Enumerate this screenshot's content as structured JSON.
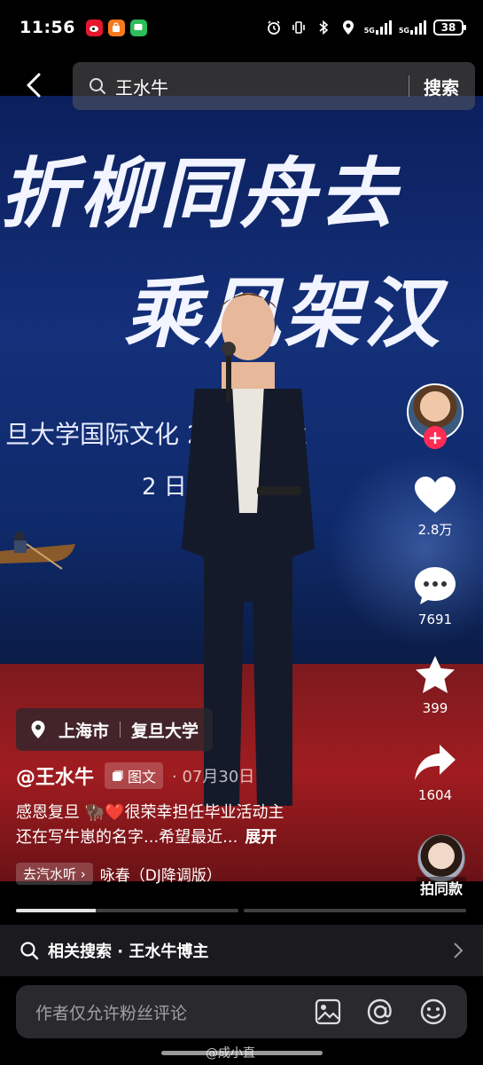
{
  "status_bar": {
    "time": "11:56",
    "network_1": "5G",
    "network_2": "5G",
    "battery": "38"
  },
  "search": {
    "query": "王水牛",
    "button_label": "搜索"
  },
  "video": {
    "banner_line1": "折柳同舟去",
    "banner_line2": "乘风架汉",
    "banner_line3": "旦大学国际文化   2026届   业",
    "banner_line4": "2         日"
  },
  "actions": {
    "likes": "2.8万",
    "comments": "7691",
    "favorites": "399",
    "shares": "1604"
  },
  "location": {
    "city": "上海市",
    "place": "复旦大学"
  },
  "post": {
    "author": "@王水牛",
    "type_tag": "图文",
    "date": "· 07月30日",
    "caption_line1": "感恩复旦 🦬❤️很荣幸担任毕业活动主",
    "caption_line2": "还在写牛崽的名字...希望最近...",
    "expand_label": "展开",
    "music_tag": "去汽水听 ›",
    "music_title": "咏春（DJ降调版）",
    "remix_label": "拍同款"
  },
  "progress": [
    0.36,
    0.0
  ],
  "related": {
    "label": "相关搜索 · 王水牛博主"
  },
  "comment": {
    "placeholder": "作者仅允许粉丝评论"
  },
  "watermark": "@成小直",
  "colors": {
    "accent": "#fe2c55",
    "background": "#000000"
  }
}
